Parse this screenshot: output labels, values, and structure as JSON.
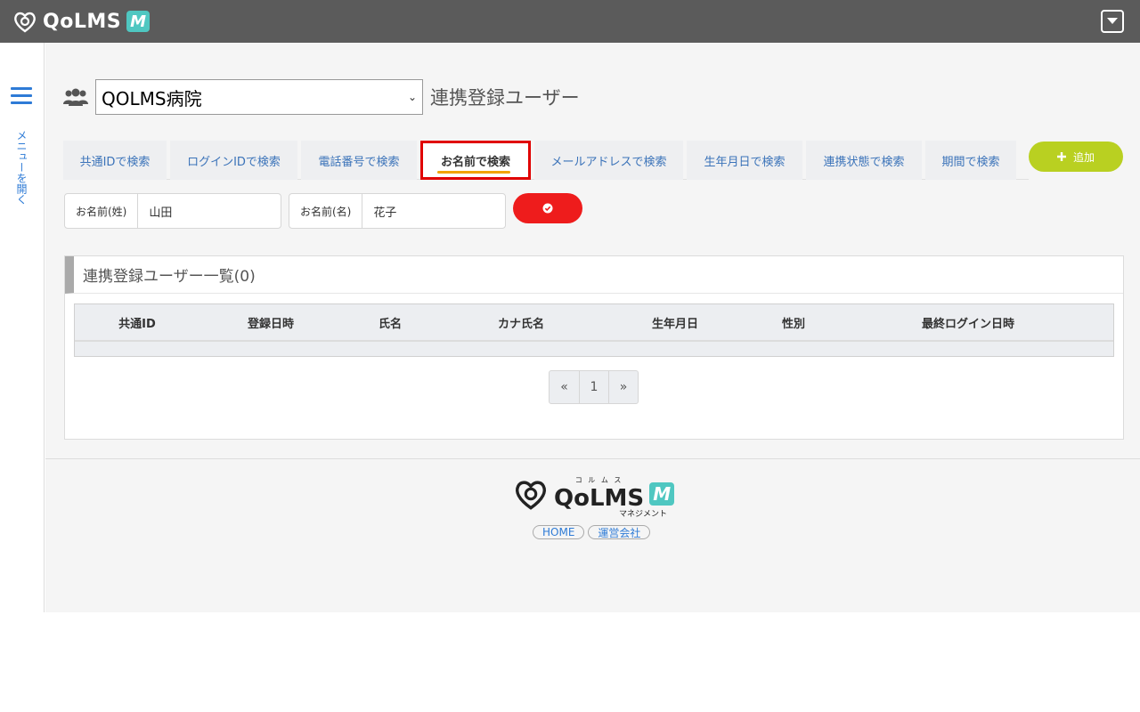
{
  "header": {
    "logo_text": "QoLMS",
    "logo_badge": "M",
    "menu_icon": "dropdown-box-icon"
  },
  "sidebar": {
    "menu_label": "メニューを開く",
    "hamburger_icon": "hamburger-icon"
  },
  "main": {
    "users_icon": "users-icon",
    "hospital_select": "QOLMS病院",
    "page_title": "連携登録ユーザー"
  },
  "tabs": [
    {
      "label": "共通IDで検索",
      "active": false
    },
    {
      "label": "ログインIDで検索",
      "active": false
    },
    {
      "label": "電話番号で検索",
      "active": false
    },
    {
      "label": "お名前で検索",
      "active": true
    },
    {
      "label": "メールアドレスで検索",
      "active": false
    },
    {
      "label": "生年月日で検索",
      "active": false
    },
    {
      "label": "連携状態で検索",
      "active": false
    },
    {
      "label": "期間で検索",
      "active": false
    }
  ],
  "add_button": {
    "label": "追加",
    "icon": "plus-icon"
  },
  "search": {
    "last_name_label": "お名前(姓)",
    "last_name_value": "山田",
    "first_name_label": "お名前(名)",
    "first_name_value": "花子",
    "submit_icon": "check-circle-icon"
  },
  "list": {
    "title": "連携登録ユーザー一覧(0)",
    "columns": [
      "共通ID",
      "登録日時",
      "氏名",
      "カナ氏名",
      "生年月日",
      "性別",
      "最終ログイン日時"
    ],
    "pagination": {
      "prev": "«",
      "page": "1",
      "next": "»"
    }
  },
  "footer": {
    "logo_text": "QoLMS",
    "logo_ruby": "コ ル ム ス",
    "logo_badge": "M",
    "subtitle": "マネジメント",
    "links": [
      "HOME",
      "運営会社"
    ]
  },
  "colors": {
    "header_bg": "#5b5b5b",
    "accent_blue": "#2e7bd6",
    "add_green": "#b9d021",
    "search_red": "#ee1c1c",
    "active_tab_border": "#e00000",
    "brand_teal": "#4fc7c1"
  }
}
